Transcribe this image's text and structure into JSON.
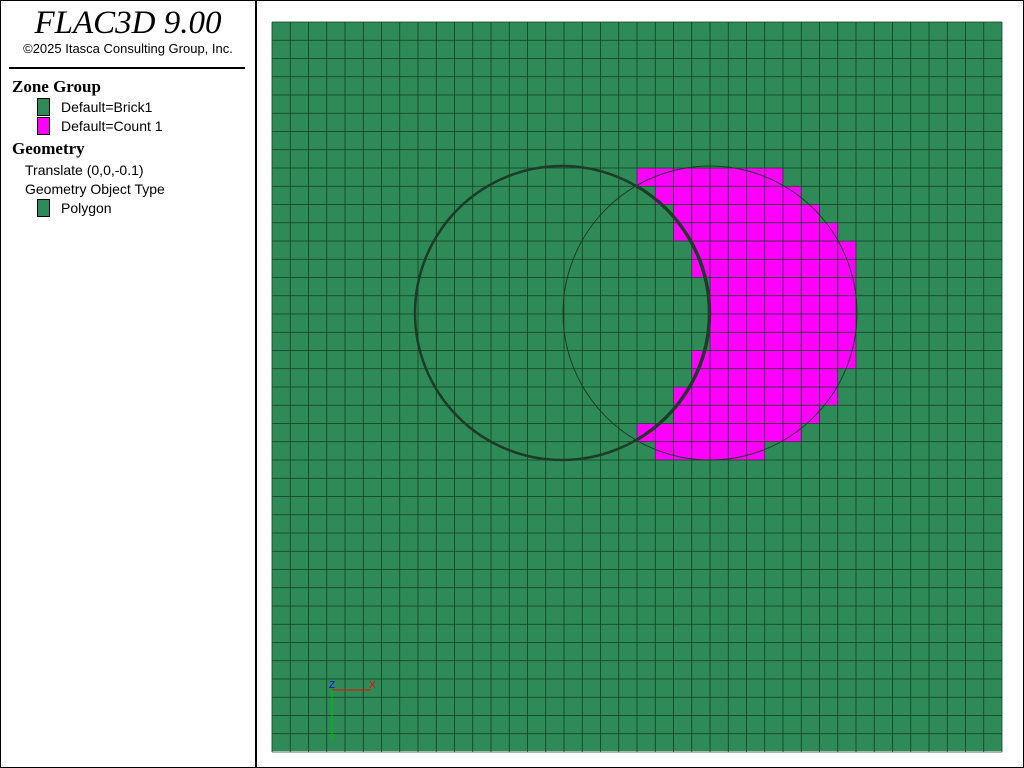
{
  "app": {
    "title": "FLAC3D 9.00",
    "copyright": "©2025 Itasca Consulting Group, Inc."
  },
  "legend": {
    "zone_group": {
      "title": "Zone Group",
      "items": [
        {
          "label": "Default=Brick1",
          "color": "#2e8b57"
        },
        {
          "label": "Default=Count 1",
          "color": "#ff00ff"
        }
      ]
    },
    "geometry": {
      "title": "Geometry",
      "translate": "Translate (0,0,-0.1)",
      "object_type_label": "Geometry Object Type",
      "items": [
        {
          "label": "Polygon",
          "color": "#2e8b57"
        }
      ]
    }
  },
  "axes": {
    "z_label": "Z",
    "x_label": "X",
    "y_label": "Y",
    "z_color": "#0000ff",
    "x_color": "#ff0000",
    "y_color": "#00c000"
  },
  "colors": {
    "zone_green": "#2e8b57",
    "zone_magenta": "#ff00ff",
    "grid_line": "#143d22",
    "outline": "#1e3a28"
  }
}
